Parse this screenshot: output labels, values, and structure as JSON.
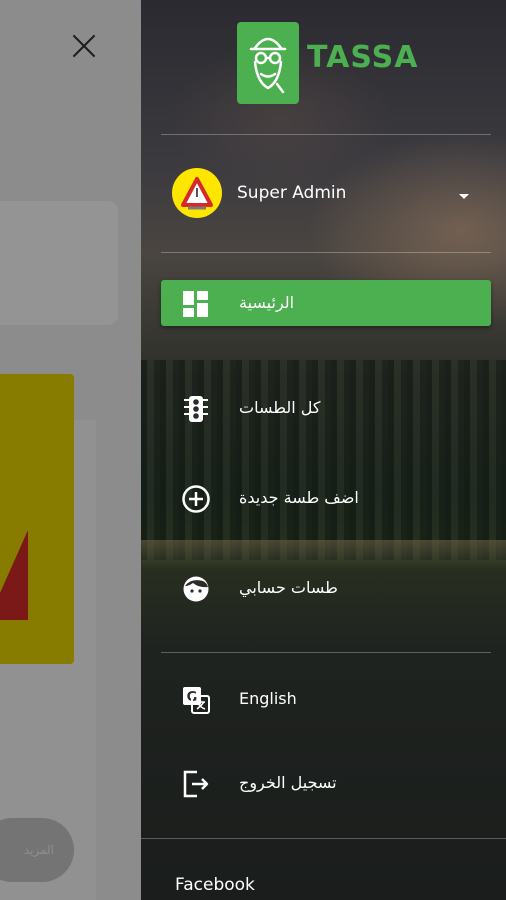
{
  "background": {
    "button_label": "المزيد"
  },
  "drawer": {
    "logo_text": "TASSA",
    "user": {
      "name": "Super Admin"
    },
    "menu": [
      {
        "label": "الرئيسية",
        "icon": "dashboard-icon",
        "active": true
      },
      {
        "label": "كل الطسات",
        "icon": "traffic-light-icon",
        "active": false
      },
      {
        "label": "اضف طسة جديدة",
        "icon": "add-circle-icon",
        "active": false
      },
      {
        "label": "طسات حسابي",
        "icon": "face-icon",
        "active": false
      }
    ],
    "secondary": [
      {
        "label": "English",
        "icon": "translate-icon"
      },
      {
        "label": "تسجيل الخروج",
        "icon": "logout-icon"
      }
    ],
    "footer_label": "Facebook"
  },
  "colors": {
    "accent": "#4caf50",
    "scrim": "#000000",
    "avatar_bg": "#ffe600",
    "warning_red": "#d42a2a",
    "card_yellow": "#e8d400"
  }
}
